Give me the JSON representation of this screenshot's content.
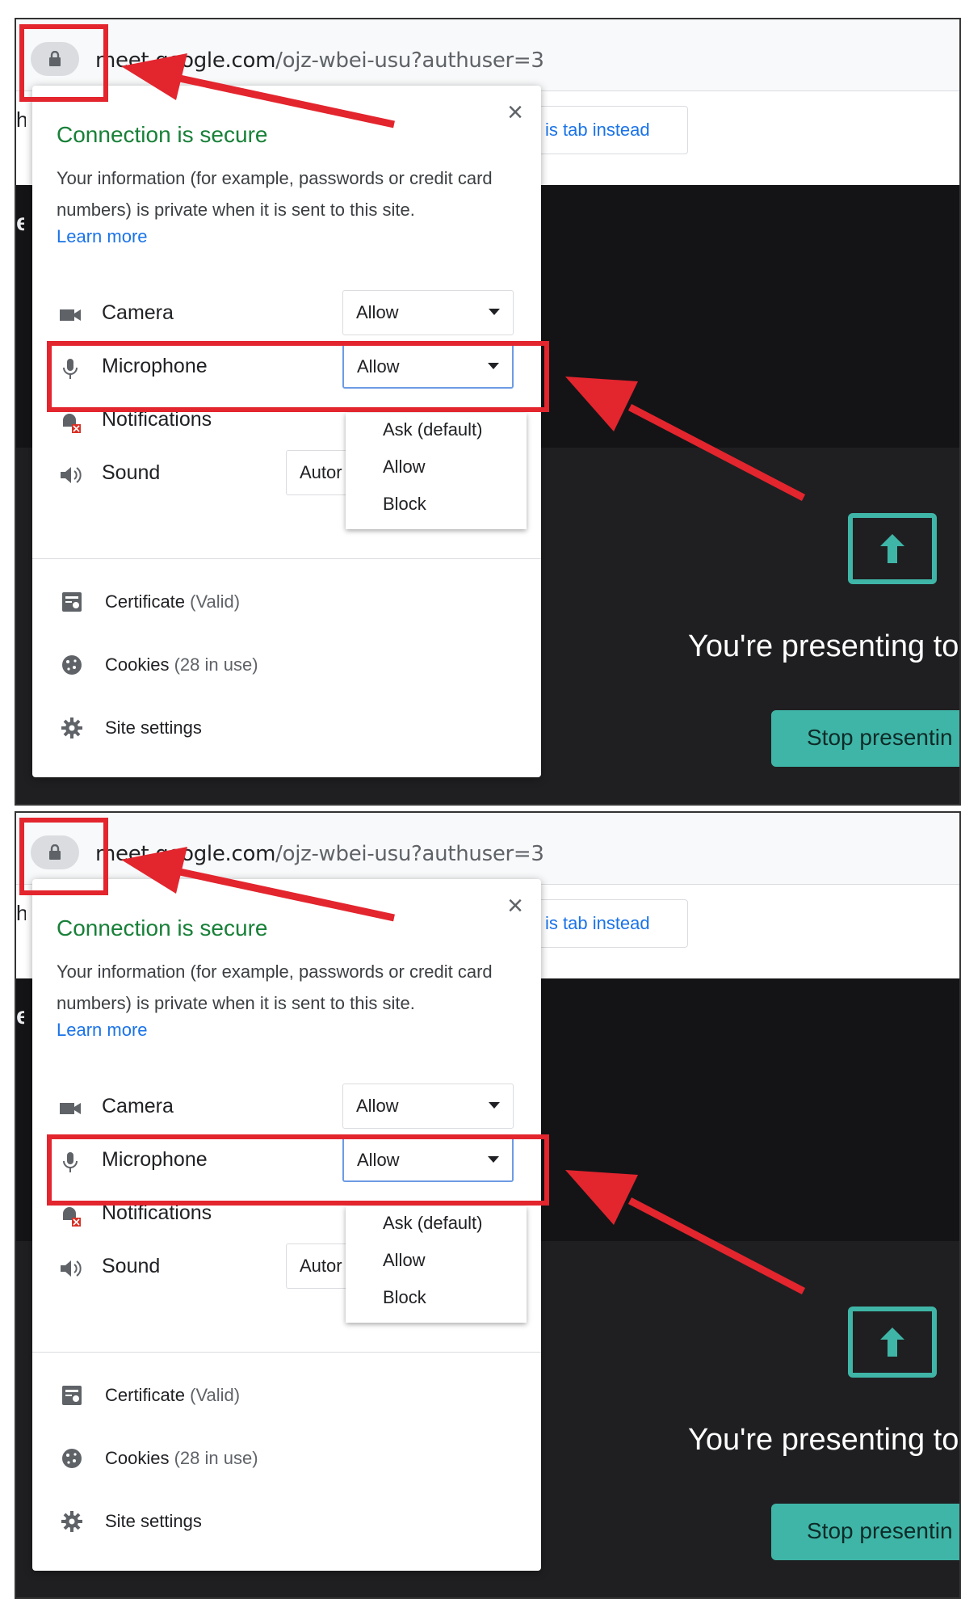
{
  "browser": {
    "url_domain": "meet.google.com",
    "url_path": "/ojz-wbei-usu?authuser=3",
    "lock_icon": "lock-icon"
  },
  "meet": {
    "infobar_button": "is tab instead",
    "edge_letter_top": "h",
    "edge_letter_stage": "e",
    "presenting_text": "You're presenting to",
    "stop_button": "Stop presentin",
    "present_icon": "arrow-up-icon"
  },
  "popup": {
    "close": "×",
    "title": "Connection is secure",
    "description": "Your information (for example, passwords or credit card numbers) is private when it is sent to this site.",
    "learn_more": "Learn more",
    "permissions": [
      {
        "icon": "camera-icon",
        "label": "Camera",
        "value": "Allow"
      },
      {
        "icon": "microphone-icon",
        "label": "Microphone",
        "value": "Allow"
      },
      {
        "icon": "notifications-icon",
        "label": "Notifications"
      },
      {
        "icon": "speaker-icon",
        "label": "Sound",
        "value": "Autor"
      }
    ],
    "dropdown_options": [
      "Ask (default)",
      "Allow",
      "Block"
    ],
    "links": [
      {
        "icon": "certificate-icon",
        "label": "Certificate",
        "sub": "(Valid)"
      },
      {
        "icon": "cookie-icon",
        "label": "Cookies",
        "sub": "(28 in use)"
      },
      {
        "icon": "gear-icon",
        "label": "Site settings",
        "sub": ""
      }
    ]
  },
  "colors": {
    "highlight": "#e3252e",
    "secure_green": "#188038",
    "link_blue": "#1a73e8",
    "meet_teal": "#3fb5a7"
  }
}
